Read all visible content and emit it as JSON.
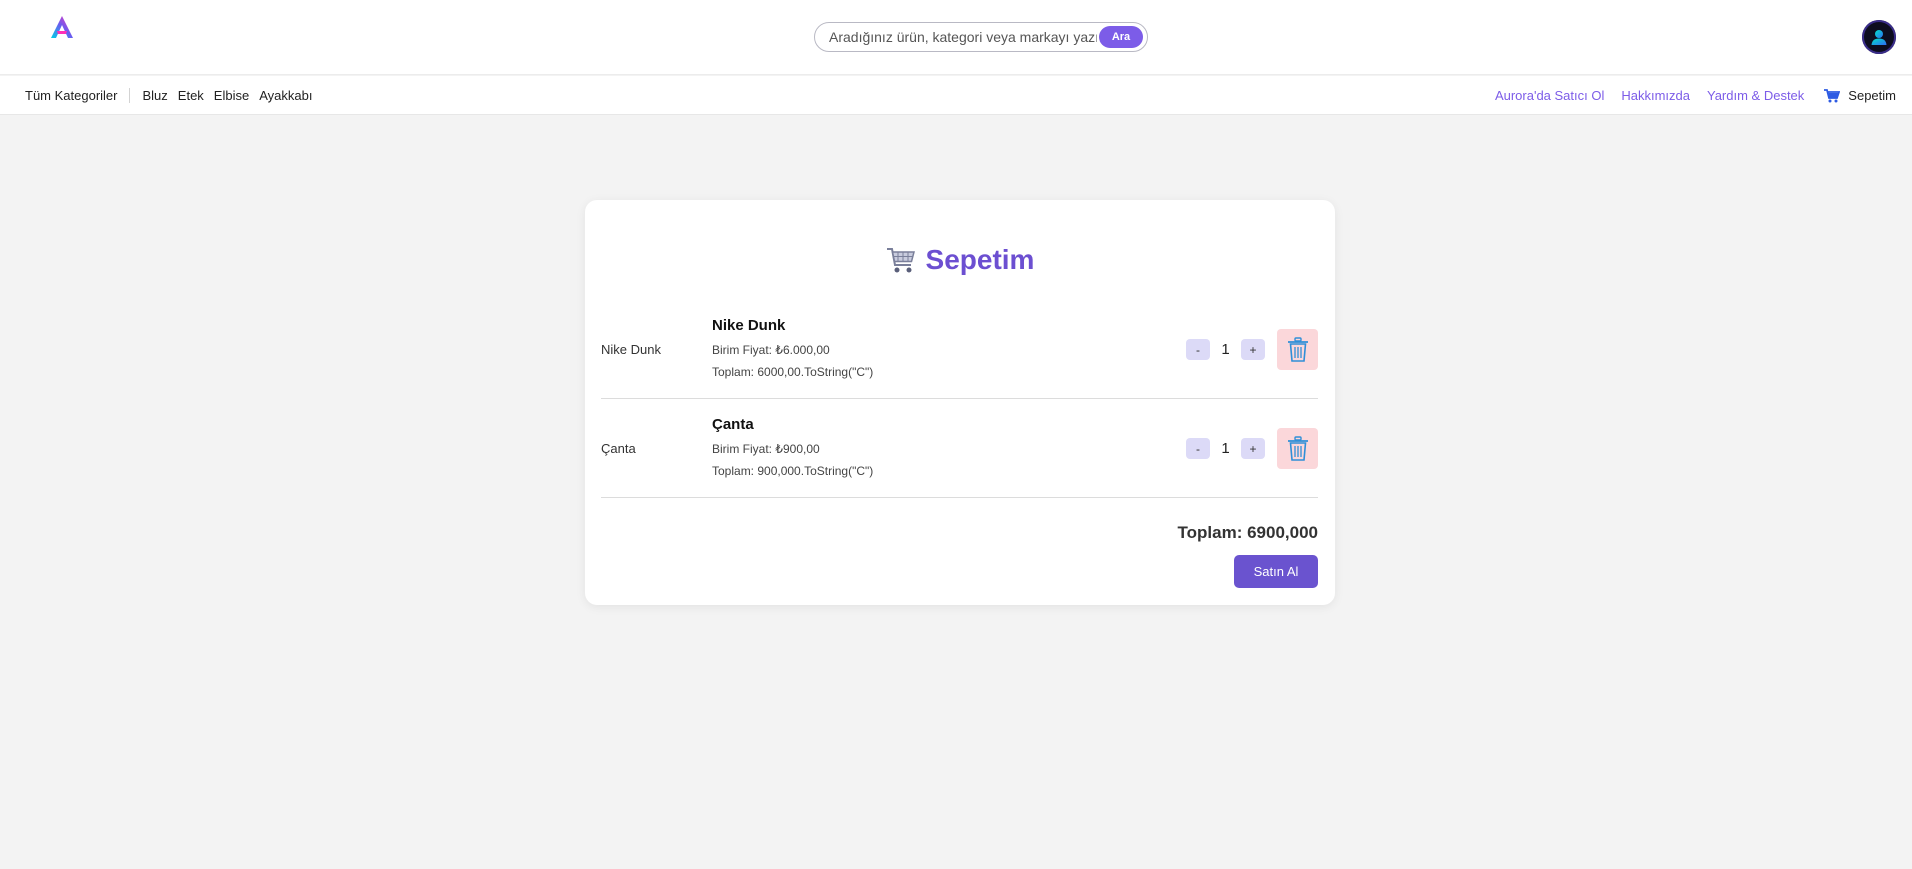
{
  "header": {
    "search": {
      "placeholder": "Aradığınız ürün, kategori veya markayı yazınız",
      "button_label": "Ara"
    }
  },
  "nav": {
    "all_categories": "Tüm Kategoriler",
    "categories": [
      "Bluz",
      "Etek",
      "Elbise",
      "Ayakkabı"
    ],
    "links": [
      "Aurora'da Satıcı Ol",
      "Hakkımızda",
      "Yardım & Destek"
    ],
    "cart_label": "Sepetim"
  },
  "cart": {
    "title": "Sepetim",
    "items": [
      {
        "image_alt": "Nike Dunk",
        "name": "Nike Dunk",
        "unit_price": "Birim Fiyat: ₺6.000,00",
        "total": "Toplam: 6000,00.ToString(\"C\")",
        "quantity": "1",
        "minus_label": "-",
        "plus_label": "+"
      },
      {
        "image_alt": "Çanta",
        "name": "Çanta",
        "unit_price": "Birim Fiyat: ₺900,00",
        "total": "Toplam: 900,000.ToString(\"C\")",
        "quantity": "1",
        "minus_label": "-",
        "plus_label": "+"
      }
    ],
    "grand_total": "Toplam: 6900,000",
    "buy_label": "Satın Al"
  },
  "colors": {
    "accent": "#7c5ce8",
    "title": "#6c4fd1",
    "buy_button": "#6a53cf",
    "qty_button": "#dcdaf7",
    "delete_button": "#fbd7da",
    "background": "#f3f3f3"
  },
  "icons": {
    "logo": "aurora-logo-icon",
    "avatar": "user-icon",
    "cart": "shopping-cart-icon",
    "delete": "trash-icon"
  }
}
